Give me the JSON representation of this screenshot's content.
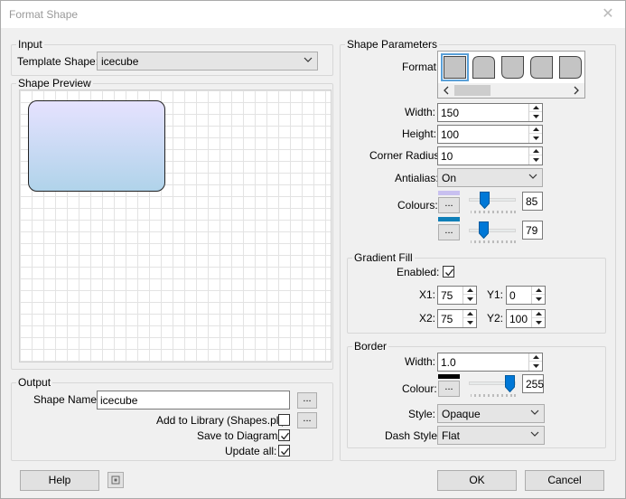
{
  "window": {
    "title": "Format Shape",
    "close_glyph": "✕"
  },
  "input": {
    "group_label": "Input",
    "template_label": "Template Shape:",
    "template_value": "icecube"
  },
  "preview": {
    "group_label": "Shape Preview"
  },
  "output": {
    "group_label": "Output",
    "shape_name_label": "Shape Name:",
    "shape_name_value": "icecube",
    "browse_label": "...",
    "add_library_label": "Add to Library (Shapes.plf):",
    "add_library_checked": false,
    "save_diagram_label": "Save to Diagram:",
    "save_diagram_checked": true,
    "update_all_label": "Update all:",
    "update_all_checked": true
  },
  "params": {
    "group_label": "Shape Parameters",
    "format_label": "Format:",
    "width_label": "Width:",
    "width_value": "150",
    "height_label": "Height:",
    "height_value": "100",
    "corner_label": "Corner Radius:",
    "corner_value": "10",
    "antialias_label": "Antialias:",
    "antialias_value": "On",
    "colours_label": "Colours:",
    "colour1": {
      "swatch": "#c8c0f0",
      "value": "85",
      "button": "..."
    },
    "colour2": {
      "swatch": "#0f7fb8",
      "value": "79",
      "button": "..."
    }
  },
  "gradient": {
    "group_label": "Gradient Fill",
    "enabled_label": "Enabled:",
    "enabled_checked": true,
    "x1_label": "X1:",
    "x1_value": "75",
    "y1_label": "Y1:",
    "y1_value": "0",
    "x2_label": "X2:",
    "x2_value": "75",
    "y2_label": "Y2:",
    "y2_value": "100"
  },
  "border": {
    "group_label": "Border",
    "width_label": "Width:",
    "width_value": "1.0",
    "colour_label": "Colour:",
    "colour_swatch": "#000000",
    "colour_value": "255",
    "colour_button": "...",
    "style_label": "Style:",
    "style_value": "Opaque",
    "dash_label": "Dash Style:",
    "dash_value": "Flat"
  },
  "footer": {
    "help_label": "Help",
    "ok_label": "OK",
    "cancel_label": "Cancel"
  }
}
